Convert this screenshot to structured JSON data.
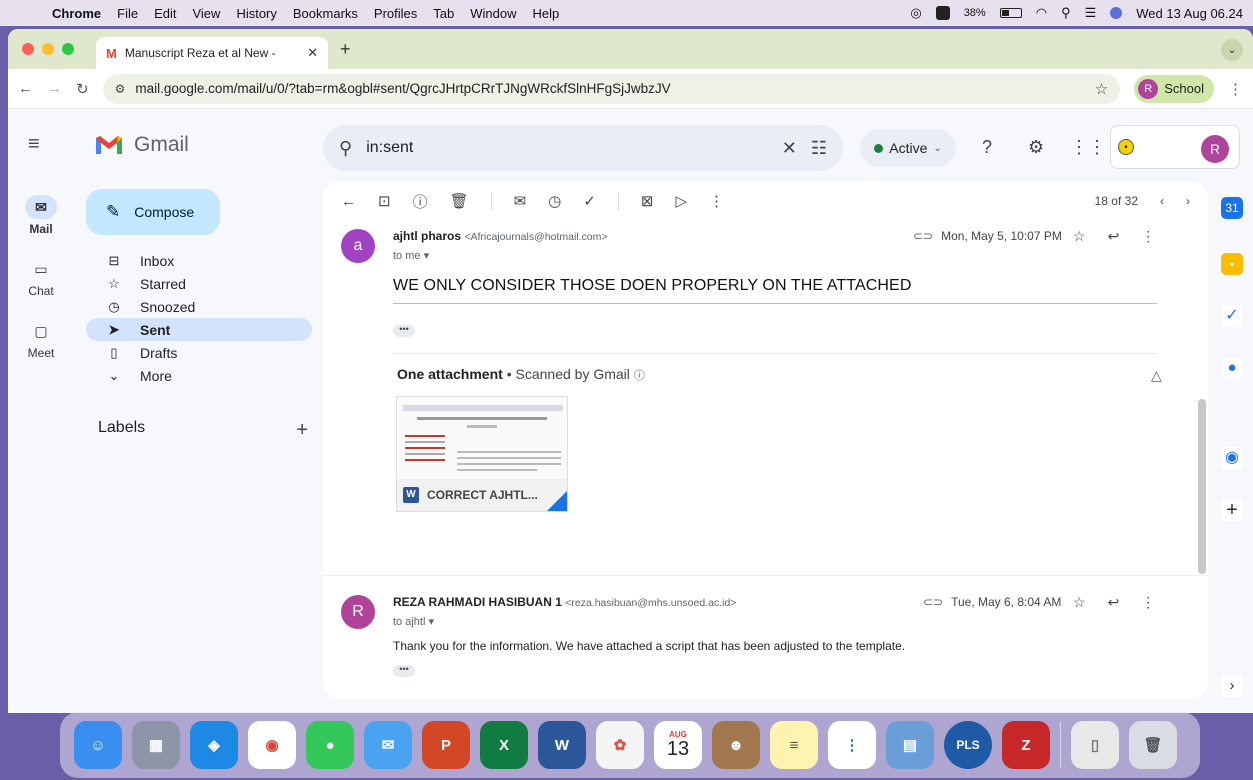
{
  "menubar": {
    "app": "Chrome",
    "items": [
      "File",
      "Edit",
      "View",
      "History",
      "Bookmarks",
      "Profiles",
      "Tab",
      "Window",
      "Help"
    ],
    "battery": "38%",
    "clock": "Wed 13 Aug 06.24"
  },
  "browser": {
    "tab_title": "Manuscript Reza et al New - ",
    "url": "mail.google.com/mail/u/0/?tab=rm&ogbl#sent/QgrcJHrtpCRrTJNgWRckfSlnHFgSjJwbzJV",
    "profile_initial": "R",
    "profile_label": "School"
  },
  "gmail": {
    "brand": "Gmail",
    "rail": [
      {
        "label": "Mail",
        "icon": "mail-icon"
      },
      {
        "label": "Chat",
        "icon": "chat-icon"
      },
      {
        "label": "Meet",
        "icon": "meet-icon"
      }
    ],
    "search_query": "in:sent",
    "status": "Active",
    "account_initial": "R",
    "compose_label": "Compose",
    "nav": [
      {
        "label": "Inbox",
        "icon": "inbox-icon"
      },
      {
        "label": "Starred",
        "icon": "star-icon"
      },
      {
        "label": "Snoozed",
        "icon": "clock-icon"
      },
      {
        "label": "Sent",
        "icon": "send-icon"
      },
      {
        "label": "Drafts",
        "icon": "draft-icon"
      },
      {
        "label": "More",
        "icon": "chevron-down-icon"
      }
    ],
    "labels_heading": "Labels",
    "pager": "18 of 32"
  },
  "messages": [
    {
      "initial": "a",
      "sender": "ajhtl pharos",
      "email": "<Africajournals@hotmail.com>",
      "to": "to me",
      "date": "Mon, May 5, 10:07 PM",
      "body": "WE ONLY CONSIDER THOSE DOEN PROPERLY ON THE ATTACHED",
      "attachment_header": "One attachment",
      "attachment_scan": "Scanned by Gmail",
      "attachment_name": "CORRECT AJHTL..."
    },
    {
      "initial": "R",
      "sender": "REZA RAHMADI HASIBUAN 1",
      "email": "<reza.hasibuan@mhs.unsoed.ac.id>",
      "to": "to ajhtl",
      "date": "Tue, May 6, 8:04 AM",
      "body": "Thank you for the information. We have attached a script that has been adjusted to the template."
    }
  ],
  "dock": {
    "calendar_month": "AUG",
    "calendar_day": "13",
    "pls_label": "PLS"
  }
}
